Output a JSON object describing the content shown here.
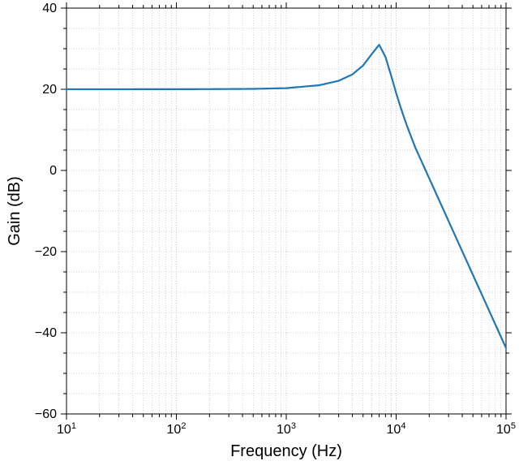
{
  "chart_data": {
    "type": "line",
    "xlabel": "Frequency (Hz)",
    "ylabel": "Gain (dB)",
    "xscale": "log",
    "xlim": [
      10,
      100000
    ],
    "ylim": [
      -60,
      40
    ],
    "x_major_ticks": [
      10,
      100,
      1000,
      10000,
      100000
    ],
    "x_tick_labels": [
      "10¹",
      "10²",
      "10³",
      "10⁴",
      "10⁵"
    ],
    "y_major_ticks": [
      -60,
      -40,
      -20,
      0,
      20,
      40
    ],
    "series": [
      {
        "name": "gain",
        "color": "#1f77b4",
        "x": [
          10,
          20,
          50,
          100,
          200,
          500,
          1000,
          2000,
          3000,
          4000,
          5000,
          6000,
          7000,
          8000,
          9000,
          10000,
          11000,
          12000,
          13000,
          15000,
          20000,
          30000,
          50000,
          70000,
          100000
        ],
        "gain": [
          20.01,
          20.01,
          20.02,
          20.02,
          20.04,
          20.1,
          20.28,
          21.0,
          22.09,
          23.67,
          25.86,
          28.67,
          30.97,
          27.96,
          23.39,
          19.09,
          15.5,
          12.48,
          9.88,
          5.53,
          -1.94,
          -12.48,
          -25.75,
          -34.49,
          -43.76
        ]
      }
    ]
  },
  "labels": {
    "x": "Frequency (Hz)",
    "y": "Gain (dB)"
  },
  "colors": {
    "line": "#1f77b4",
    "grid": "#aaaaaa",
    "frame": "#000000",
    "text": "#000000"
  }
}
